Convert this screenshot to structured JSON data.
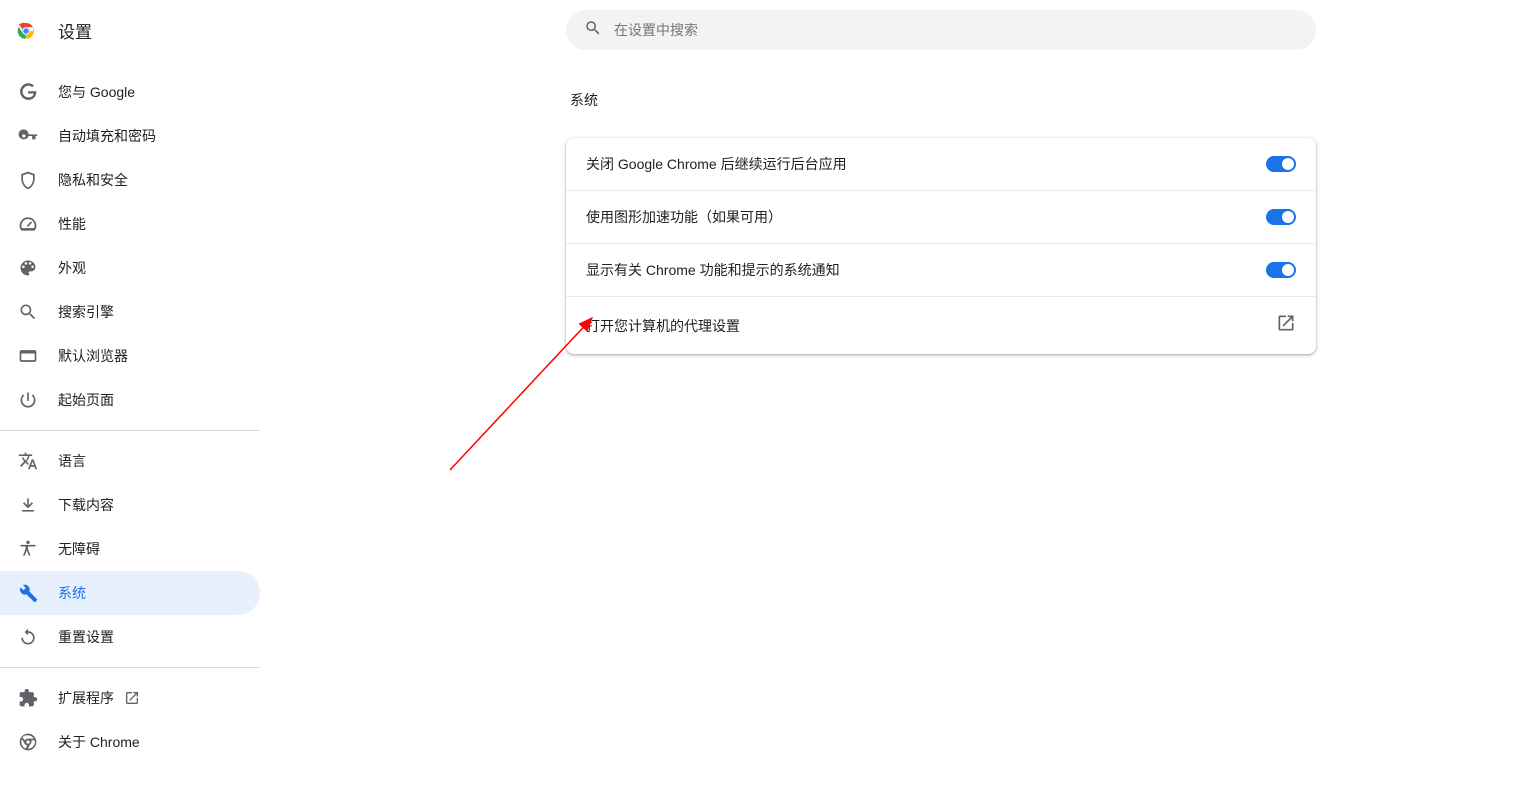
{
  "header": {
    "title": "设置"
  },
  "search": {
    "placeholder": "在设置中搜索"
  },
  "sidebar": {
    "groups": [
      [
        {
          "id": "you-and-google",
          "label": "您与 Google"
        },
        {
          "id": "autofill",
          "label": "自动填充和密码"
        },
        {
          "id": "privacy",
          "label": "隐私和安全"
        },
        {
          "id": "performance",
          "label": "性能"
        },
        {
          "id": "appearance",
          "label": "外观"
        },
        {
          "id": "search-engine",
          "label": "搜索引擎"
        },
        {
          "id": "default-browser",
          "label": "默认浏览器"
        },
        {
          "id": "on-startup",
          "label": "起始页面"
        }
      ],
      [
        {
          "id": "languages",
          "label": "语言"
        },
        {
          "id": "downloads",
          "label": "下载内容"
        },
        {
          "id": "accessibility",
          "label": "无障碍"
        },
        {
          "id": "system",
          "label": "系统",
          "active": true
        },
        {
          "id": "reset",
          "label": "重置设置"
        }
      ],
      [
        {
          "id": "extensions",
          "label": "扩展程序",
          "external": true
        },
        {
          "id": "about",
          "label": "关于 Chrome"
        }
      ]
    ]
  },
  "content": {
    "section_title": "系统",
    "rows": [
      {
        "label": "关闭 Google Chrome 后继续运行后台应用",
        "type": "toggle",
        "value": true
      },
      {
        "label": "使用图形加速功能（如果可用）",
        "type": "toggle",
        "value": true
      },
      {
        "label": "显示有关 Chrome 功能和提示的系统通知",
        "type": "toggle",
        "value": true
      },
      {
        "label": "打开您计算机的代理设置",
        "type": "link"
      }
    ]
  },
  "colors": {
    "accent": "#1a73e8",
    "active_bg": "#e8f0fe",
    "arrow": "#ff0000"
  }
}
